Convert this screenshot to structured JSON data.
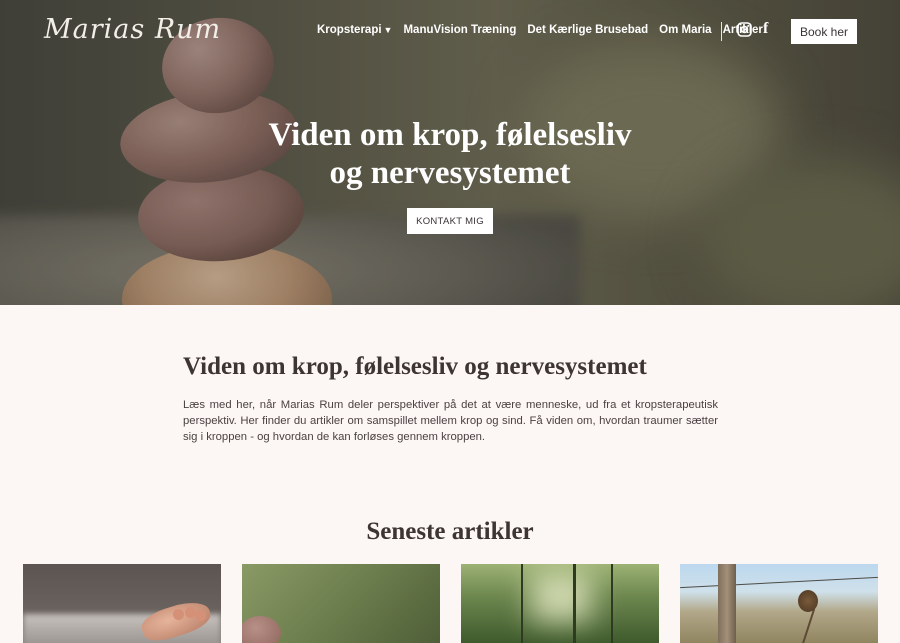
{
  "header": {
    "logo_text": "Marias Rum",
    "nav": [
      {
        "label": "Kropsterapi",
        "has_dropdown": true
      },
      {
        "label": "ManuVision Træning"
      },
      {
        "label": "Det Kærlige Brusebad"
      },
      {
        "label": "Om Maria"
      },
      {
        "label": "Artikler"
      }
    ],
    "social_icons": [
      "instagram-icon",
      "facebook-icon"
    ],
    "book_label": "Book her"
  },
  "hero": {
    "title": "Viden om krop, følelsesliv og nervesystemet",
    "cta_label": "KONTAKT MIG"
  },
  "intro": {
    "title": "Viden om krop, følelsesliv og nervesystemet",
    "text": "Læs med her, når Marias Rum deler perspektiver på det at være menneske, ud fra et kropsterapeutisk perspektiv. Her finder du artikler om samspillet mellem krop og sind. Få viden om, hvordan traumer sætter sig i kroppen - og hvordan de kan forløses gennem kroppen."
  },
  "latest": {
    "title": "Seneste artikler",
    "cards": [
      {
        "image": "feet-on-blanket"
      },
      {
        "image": "stone-on-green"
      },
      {
        "image": "forest-path"
      },
      {
        "image": "fence-post-field"
      }
    ]
  },
  "colors": {
    "background": "#fcf6f4",
    "text": "#3a3434",
    "button_bg": "#ffffff"
  }
}
